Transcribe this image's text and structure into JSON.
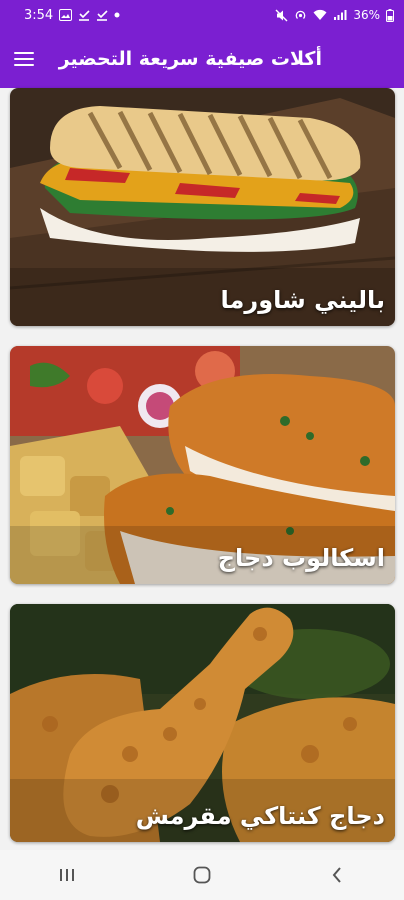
{
  "status_bar": {
    "time": "3:54",
    "battery": "36%"
  },
  "app_bar": {
    "title": "أكلات صيفية سريعة التحضير"
  },
  "recipes": [
    {
      "title": "باليني شاورما"
    },
    {
      "title": "اسكالوب دجاج"
    },
    {
      "title": "دجاج كنتاكي مقرمش"
    }
  ],
  "colors": {
    "primary": "#7b1fd1"
  }
}
